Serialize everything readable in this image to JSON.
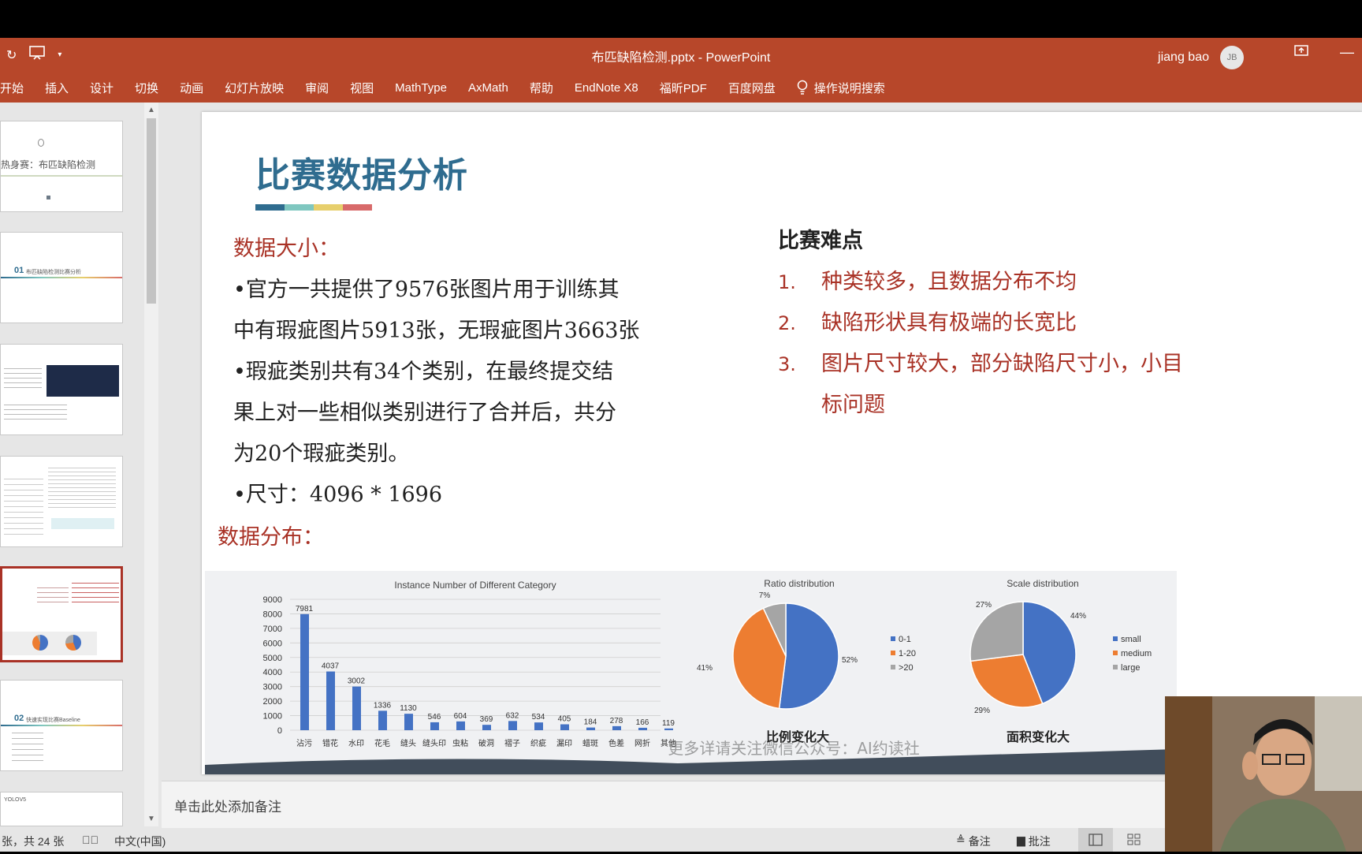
{
  "window": {
    "doc_title": "布匹缺陷检测.pptx  -  PowerPoint",
    "user_name": "jiang bao",
    "user_initials": "JB"
  },
  "ribbon": {
    "tabs": [
      "开始",
      "插入",
      "设计",
      "切换",
      "动画",
      "幻灯片放映",
      "审阅",
      "视图",
      "MathType",
      "AxMath",
      "帮助",
      "EndNote X8",
      "福昕PDF",
      "百度网盘"
    ],
    "tell_me": "操作说明搜索"
  },
  "thumbnails": {
    "t1_title": "热身赛：布匹缺陷检测",
    "t2_num": "01",
    "t2_text": "布匹缺陷检测比赛分析",
    "t6_num": "02",
    "t6_text": "快速实现比赛Baseline",
    "t7_text": "YOLOV5"
  },
  "slide": {
    "title": "比赛数据分析",
    "title_line_colors": [
      "#2f6c8f",
      "#7fc7c0",
      "#e7cf6c",
      "#d86a6a"
    ],
    "data_size_heading": "数据大小：",
    "para1_line1": "•官方一共提供了9576张图片用于训练其",
    "para1_line2": "中有瑕疵图片5913张，无瑕疵图片3663张",
    "para2_line1": "•瑕疵类别共有34个类别，在最终提交结",
    "para2_line2": "果上对一些相似类别进行了合并后，共分",
    "para2_line3": "为20个瑕疵类别。",
    "para3": "•尺寸：4096 * 1696",
    "dist_heading": "数据分布：",
    "difficulty_heading": "比赛难点",
    "difficulties": [
      {
        "num": "1.",
        "text": "种类较多，且数据分布不均"
      },
      {
        "num": "2.",
        "text": "缺陷形状具有极端的长宽比"
      },
      {
        "num": "3.",
        "text": "图片尺寸较大，部分缺陷尺寸小，小目"
      }
    ],
    "difficulty3_cont": "标问题",
    "watermark": "更多详请关注微信公众号：AI约读社"
  },
  "chart_data": [
    {
      "type": "bar",
      "title": "Instance Number of Different Category",
      "categories": [
        "沾污",
        "错花",
        "水印",
        "花毛",
        "缝头",
        "缝头印",
        "虫粘",
        "破洞",
        "褶子",
        "织疵",
        "漏印",
        "蜡斑",
        "色差",
        "网折",
        "其他"
      ],
      "values": [
        7981,
        4037,
        3002,
        1336,
        1130,
        546,
        604,
        369,
        632,
        534,
        405,
        184,
        278,
        166,
        119
      ],
      "ylim": [
        0,
        9000
      ],
      "yticks": [
        0,
        1000,
        2000,
        3000,
        4000,
        5000,
        6000,
        7000,
        8000,
        9000
      ],
      "color": "#4472c4",
      "grid": true
    },
    {
      "type": "pie",
      "title": "Ratio distribution",
      "labels": [
        "0-1",
        "1-20",
        ">20"
      ],
      "values": [
        52,
        41,
        7
      ],
      "value_labels": [
        "52%",
        "41%",
        "7%"
      ],
      "colors": [
        "#4472c4",
        "#ed7d31",
        "#a5a5a5"
      ],
      "caption": "比例变化大",
      "legend": "right"
    },
    {
      "type": "pie",
      "title": "Scale distribution",
      "labels": [
        "small",
        "medium",
        "large"
      ],
      "values": [
        44,
        29,
        27
      ],
      "value_labels": [
        "44%",
        "29%",
        "27%"
      ],
      "colors": [
        "#4472c4",
        "#ed7d31",
        "#a5a5a5"
      ],
      "caption": "面积变化大",
      "legend": "right"
    }
  ],
  "notes": {
    "placeholder": "单击此处添加备注"
  },
  "status": {
    "slide_count": "张，共 24 张",
    "language": "中文(中国)",
    "notes_btn": "备注",
    "comments_btn": "批注"
  }
}
